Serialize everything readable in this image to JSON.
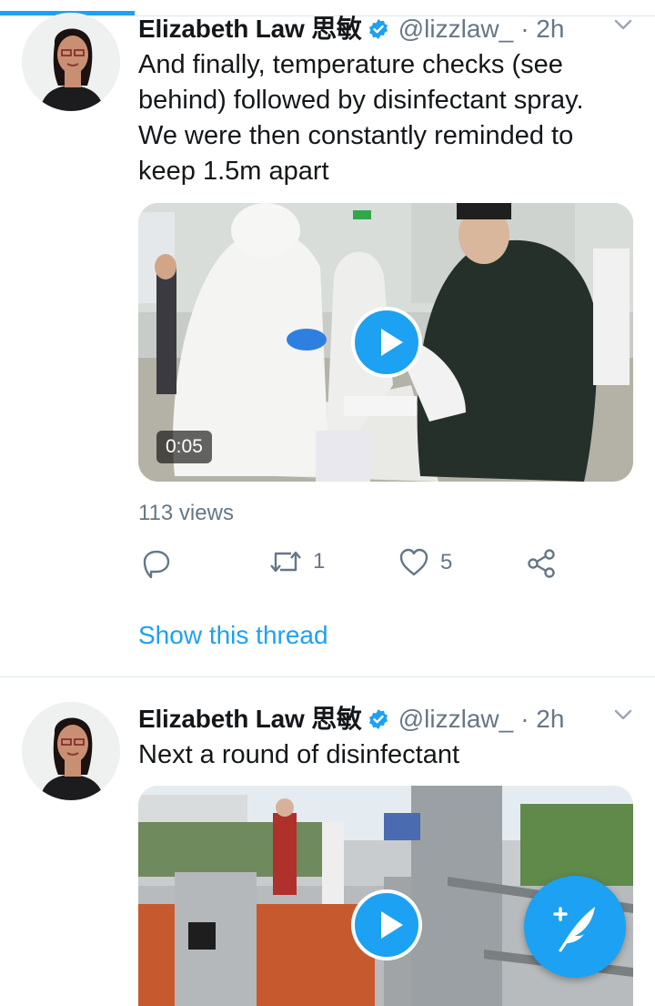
{
  "tweets": [
    {
      "author_name": "Elizabeth Law 思敏",
      "handle": "@lizzlaw_",
      "time": "· 2h",
      "text": "And finally, temperature checks (see behind) followed by disinfectant spray. We were then constantly reminded to keep 1.5m apart",
      "video_duration": "0:05",
      "views": "113 views",
      "retweet_count": "1",
      "like_count": "5",
      "show_thread": "Show this thread"
    },
    {
      "author_name": "Elizabeth Law 思敏",
      "handle": "@lizzlaw_",
      "time": "· 2h",
      "text": "Next a round of disinfectant"
    }
  ],
  "icons": {
    "verified": "verified-badge-icon",
    "chevron": "chevron-down-icon",
    "reply": "reply-icon",
    "retweet": "retweet-icon",
    "like": "heart-icon",
    "share": "share-icon",
    "compose": "compose-tweet-icon",
    "play": "play-icon"
  },
  "colors": {
    "accent": "#1da1f2",
    "text": "#14171a",
    "secondary_text": "#657786",
    "divider": "#e1e8ed"
  }
}
